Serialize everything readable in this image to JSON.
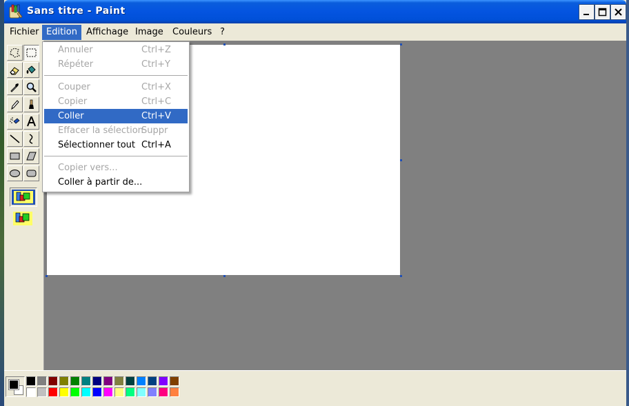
{
  "window": {
    "title": "Sans titre - Paint"
  },
  "menubar": {
    "items": [
      "Fichier",
      "Edition",
      "Affichage",
      "Image",
      "Couleurs",
      "?"
    ],
    "active": "Edition"
  },
  "edit_menu": {
    "items": [
      {
        "label": "Annuler",
        "shortcut": "Ctrl+Z",
        "enabled": false
      },
      {
        "label": "Répéter",
        "shortcut": "Ctrl+Y",
        "enabled": false
      },
      {
        "label": "Couper",
        "shortcut": "Ctrl+X",
        "enabled": false
      },
      {
        "label": "Copier",
        "shortcut": "Ctrl+C",
        "enabled": false
      },
      {
        "label": "Coller",
        "shortcut": "Ctrl+V",
        "enabled": true,
        "highlighted": true
      },
      {
        "label": "Effacer la sélection",
        "shortcut": "Suppr",
        "enabled": false
      },
      {
        "label": "Sélectionner tout",
        "shortcut": "Ctrl+A",
        "enabled": true
      },
      {
        "label": "Copier vers...",
        "shortcut": "",
        "enabled": false
      },
      {
        "label": "Coller à partir de...",
        "shortcut": "",
        "enabled": true
      }
    ]
  },
  "toolbox": {
    "tools": [
      "free-select",
      "rect-select",
      "eraser",
      "fill",
      "color-picker",
      "magnifier",
      "pencil",
      "brush",
      "airbrush",
      "text",
      "line",
      "curve",
      "rectangle",
      "polygon",
      "ellipse",
      "rounded-rectangle"
    ],
    "selected": "rect-select"
  },
  "palette": {
    "foreground": "#000000",
    "background": "#ffffff",
    "top_row": [
      "#000000",
      "#808080",
      "#800000",
      "#808000",
      "#008000",
      "#008080",
      "#000080",
      "#800080",
      "#808040",
      "#004040",
      "#0080ff",
      "#004080",
      "#8000ff",
      "#804000"
    ],
    "bottom_row": [
      "#ffffff",
      "#c0c0c0",
      "#ff0000",
      "#ffff00",
      "#00ff00",
      "#00ffff",
      "#0000ff",
      "#ff00ff",
      "#ffff80",
      "#00ff80",
      "#80ffff",
      "#8080ff",
      "#ff0080",
      "#ff8040"
    ]
  }
}
